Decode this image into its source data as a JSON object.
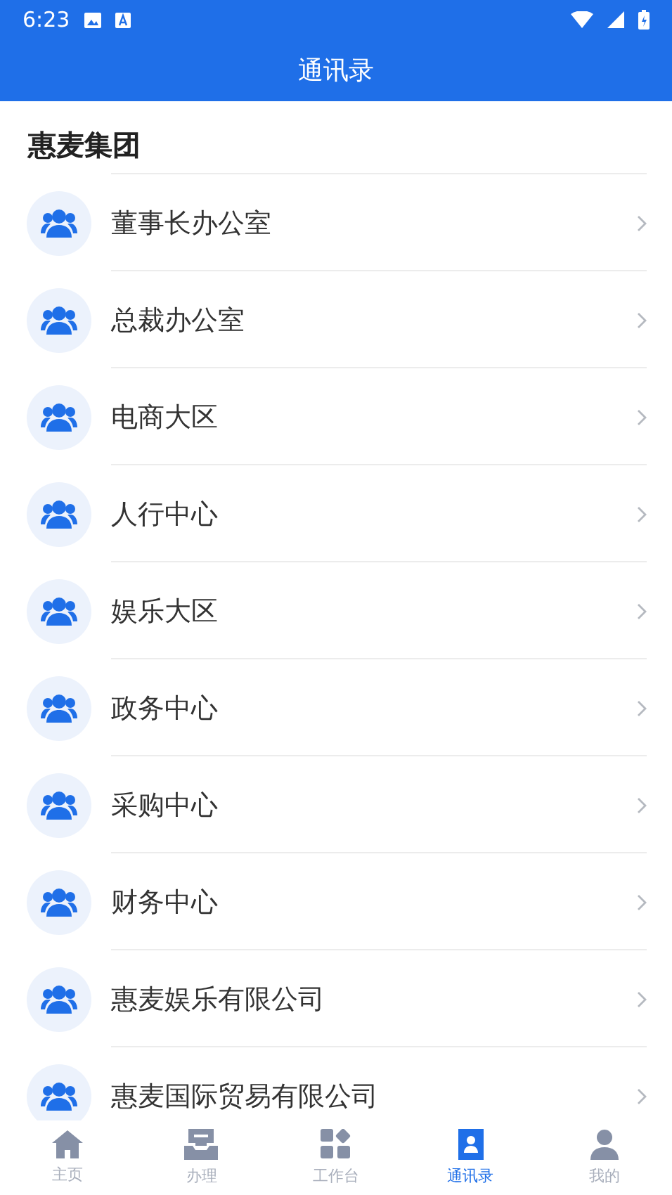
{
  "status_bar": {
    "time": "6:23"
  },
  "header": {
    "title": "通讯录"
  },
  "group": {
    "title": "惠麦集团"
  },
  "departments": [
    {
      "name": "董事长办公室"
    },
    {
      "name": "总裁办公室"
    },
    {
      "name": "电商大区"
    },
    {
      "name": "人行中心"
    },
    {
      "name": "娱乐大区"
    },
    {
      "name": "政务中心"
    },
    {
      "name": "采购中心"
    },
    {
      "name": "财务中心"
    },
    {
      "name": "惠麦娱乐有限公司"
    },
    {
      "name": "惠麦国际贸易有限公司"
    }
  ],
  "tab_bar": [
    {
      "label": "主页",
      "kind": "home",
      "selected": false
    },
    {
      "label": "办理",
      "kind": "inbox",
      "selected": false
    },
    {
      "label": "工作台",
      "kind": "grid",
      "selected": false
    },
    {
      "label": "通讯录",
      "kind": "contacts",
      "selected": true
    },
    {
      "label": "我的",
      "kind": "person",
      "selected": false
    }
  ]
}
